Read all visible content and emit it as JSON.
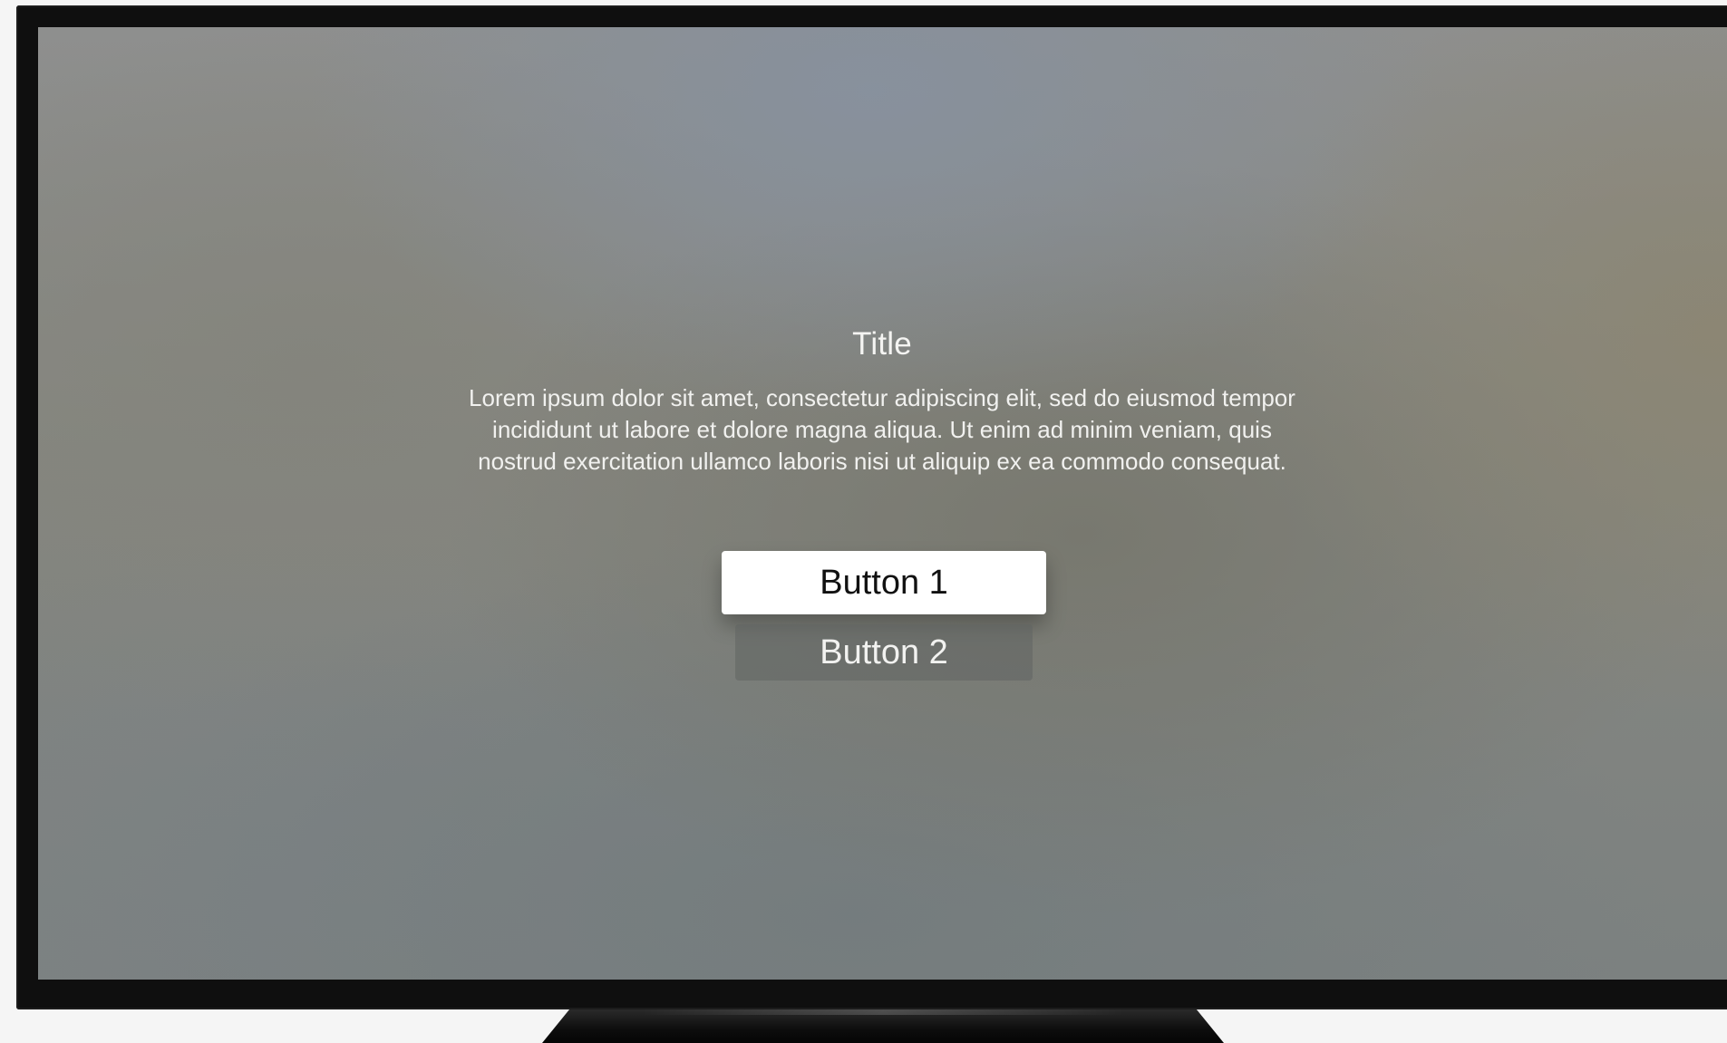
{
  "alert": {
    "title": "Title",
    "message": "Lorem ipsum dolor sit amet, consectetur adipiscing elit, sed do eiusmod tempor incididunt ut labore et dolore magna aliqua. Ut enim ad minim veniam, quis nostrud exercitation ullamco laboris nisi ut aliquip ex ea commodo consequat.",
    "buttons": [
      {
        "label": "Button 1",
        "state": "focused"
      },
      {
        "label": "Button 2",
        "state": "normal"
      }
    ]
  },
  "colors": {
    "bezel": "#0f0f0f",
    "focused_button_bg": "#ffffff",
    "focused_button_text": "#111111",
    "text_light": "#f4f4f2"
  }
}
